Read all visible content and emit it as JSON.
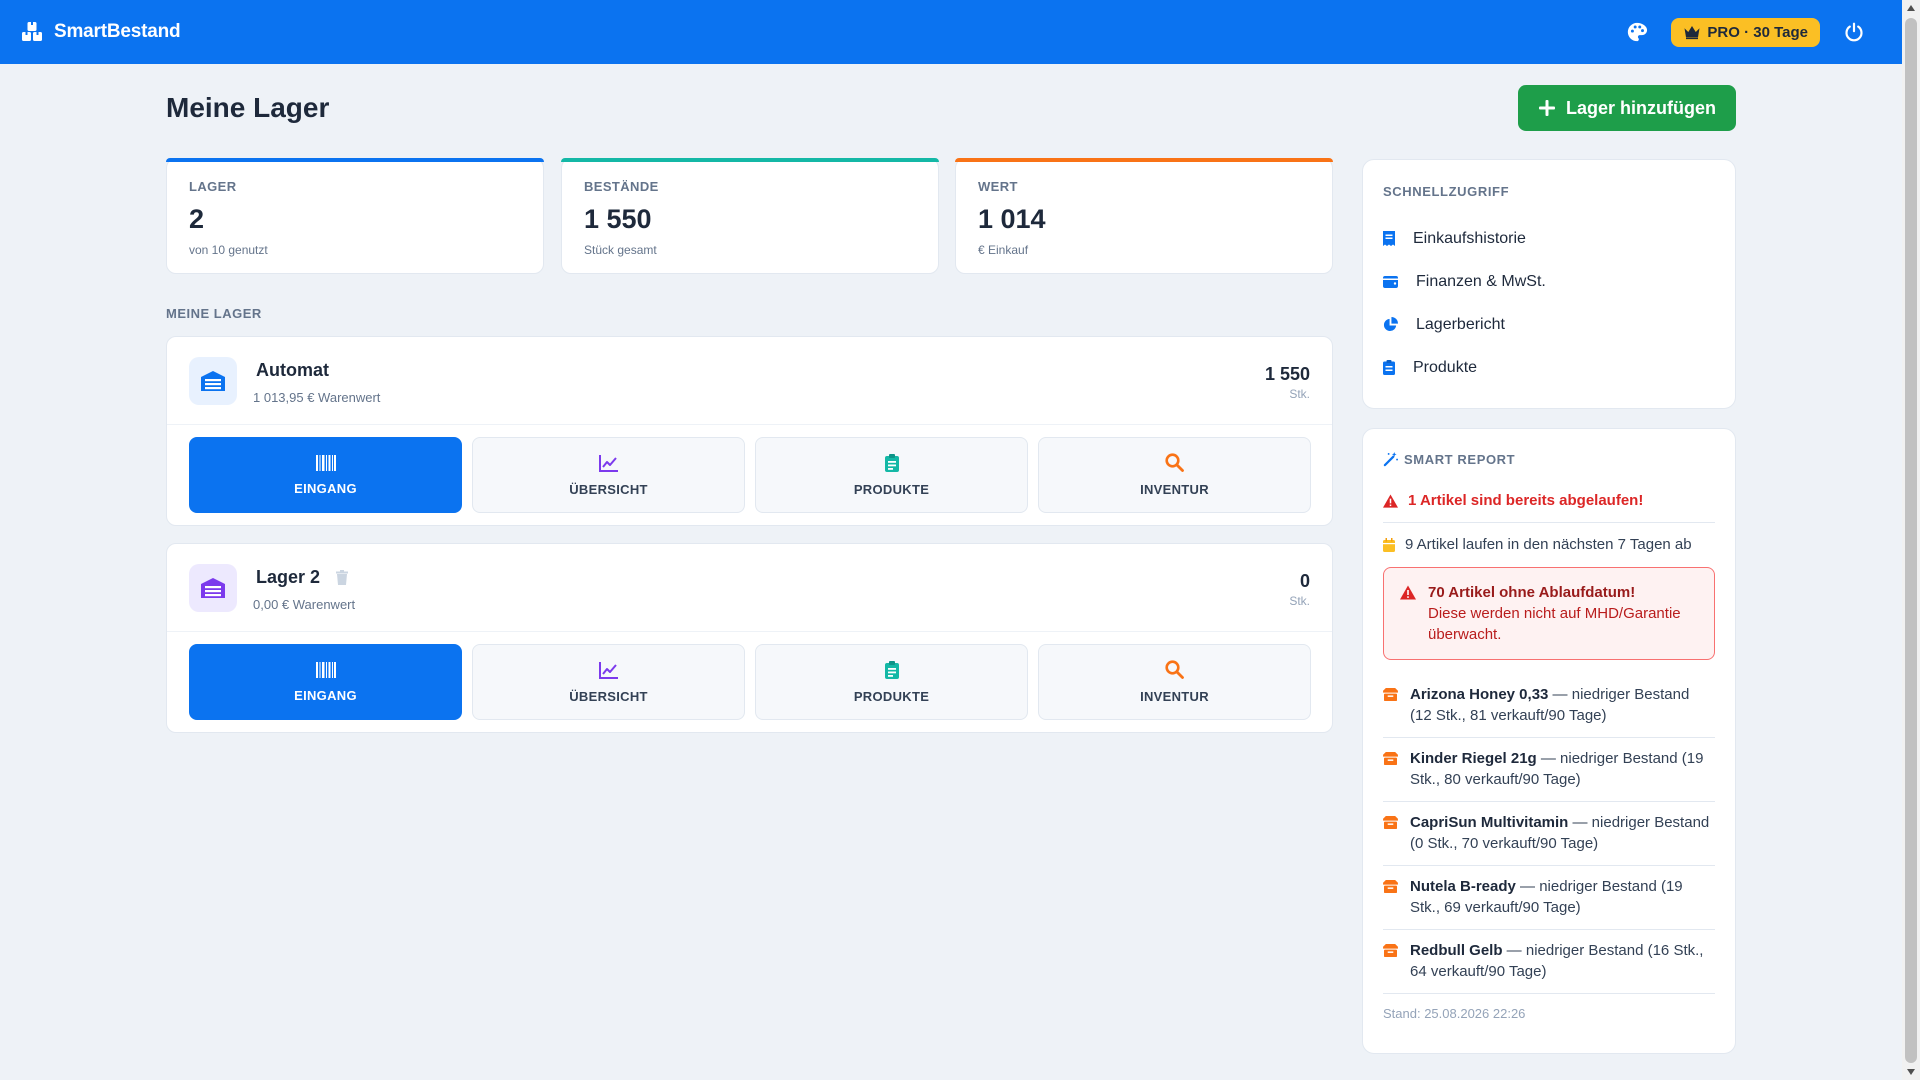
{
  "app": {
    "brand": "SmartBestand",
    "pro_badge": "PRO · 30 Tage"
  },
  "colors": {
    "primary": "#0b73f0",
    "success": "#1e9e4a",
    "pro": "#fbbf24",
    "danger": "#dc2626"
  },
  "page": {
    "title": "Meine Lager",
    "add_button": "Lager hinzufügen",
    "section_label": "MEINE LAGER"
  },
  "stats": [
    {
      "label": "LAGER",
      "value": "2",
      "sub": "von 10 genutzt"
    },
    {
      "label": "BESTÄNDE",
      "value": "1 550",
      "sub": "Stück gesamt"
    },
    {
      "label": "WERT",
      "value": "1 014",
      "sub": "€ Einkauf"
    }
  ],
  "lager": [
    {
      "name": "Automat",
      "value": "1 013,95 € Warenwert",
      "count": "1 550",
      "unit": "Stk.",
      "icon": "warehouse-icon",
      "actions": [
        "EINGANG",
        "ÜBERSICHT",
        "PRODUKTE",
        "INVENTUR"
      ]
    },
    {
      "name": "Lager 2",
      "value": "0,00 € Warenwert",
      "count": "0",
      "unit": "Stk.",
      "icon": "warehouse-icon",
      "actions": [
        "EINGANG",
        "ÜBERSICHT",
        "PRODUKTE",
        "INVENTUR"
      ]
    }
  ],
  "quick_access": {
    "title": "SCHNELLZUGRIFF",
    "items": [
      {
        "label": "Einkaufshistorie",
        "icon": "receipt-icon"
      },
      {
        "label": "Finanzen & MwSt.",
        "icon": "wallet-icon"
      },
      {
        "label": "Lagerbericht",
        "icon": "pie-chart-icon"
      },
      {
        "label": "Produkte",
        "icon": "clipboard-icon"
      }
    ]
  },
  "smart_report": {
    "title": "SMART REPORT",
    "expired": "1 Artikel sind bereits abgelaufen!",
    "expiring": "9 Artikel laufen in den nächsten 7 Tagen ab",
    "warn_title": "70 Artikel ohne Ablaufdatum!",
    "warn_text": "Diese werden nicht auf MHD/Garantie überwacht.",
    "low_stock": [
      {
        "name": "Arizona Honey 0,33",
        "text": " — niedriger Bestand (12 Stk., 81 verkauft/90 Tage)"
      },
      {
        "name": "Kinder Riegel 21g",
        "text": " — niedriger Bestand (19 Stk., 80 verkauft/90 Tage)"
      },
      {
        "name": "CapriSun Multivitamin",
        "text": " — niedriger Bestand (0 Stk., 70 verkauft/90 Tage)"
      },
      {
        "name": "Nutela B-ready",
        "text": " — niedriger Bestand (19 Stk., 69 verkauft/90 Tage)"
      },
      {
        "name": "Redbull Gelb",
        "text": " — niedriger Bestand (16 Stk., 64 verkauft/90 Tage)"
      }
    ],
    "footer": "Stand: 25.08.2026 22:26"
  }
}
